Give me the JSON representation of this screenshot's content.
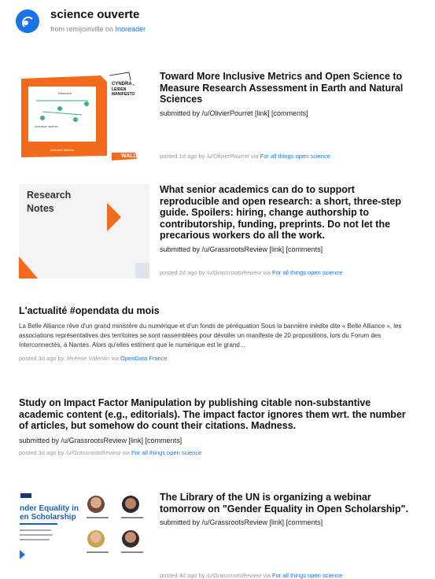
{
  "header": {
    "feed_title": "science ouverte",
    "from_prefix": "from remijoinville on",
    "from_service": "Inoreader"
  },
  "items": [
    {
      "title": "Toward More Inclusive Metrics and Open Science to Measure Research Assessment in Earth and Natural Sciences",
      "submitted": "submitted by /u/OlivierPourret [link] [comments]",
      "meta_prefix": "posted 1d ago by",
      "author": "/u/OlivierPourret",
      "via": "via",
      "source": "For all things open science",
      "thumb": {
        "words": [
          "CYNDRA , LEIDEN MANIFESTO",
          "WALL"
        ]
      }
    },
    {
      "title": "What senior academics can do to support reproducible and open research: a short, three-step guide. Spoilers: hiring, change authorship to contributorship, funding, preprints. Do not let the precarious workers do all the work.",
      "submitted": "submitted by /u/GrassrootsReview [link] [comments]",
      "meta_prefix": "posted 2d ago by",
      "author": "/u/GrassrootsReview",
      "via": "via",
      "source": "For all things open science",
      "thumb": {
        "label_line1": "Research",
        "label_line2": "Notes"
      }
    },
    {
      "title": "L'actualité #opendata du mois",
      "snippet": "La Belle Alliance rêve d'un grand ministère du numérique et d'un fonds de péréquation Sous la bannière inédite dite « Belle Alliance », les associations représentatives des territoires se sont rassemblées pour dévoiler un manifeste de 20 propositions, lors du Forum des Interconnectés, à Nantes. Alors qu'elles estiment que le numérique est le grand…",
      "meta_prefix": "posted 3d ago by",
      "author": "Jérémie Valentin",
      "via": "via",
      "source": "OpenData France"
    },
    {
      "title": "Study on Impact Factor Manipulation by publishing citable non-substantive academic content (e.g., editorials). The impact factor ignores them wrt. the number of articles, but somehow do count their citations. Madness.",
      "submitted": "submitted by /u/GrassrootsReview [link] [comments]",
      "meta_prefix": "posted 3d ago by",
      "author": "/u/GrassrootsReview",
      "via": "via",
      "source": "For all things open science"
    },
    {
      "title": "The Library of the UN is organizing a webinar tomorrow on \"Gender Equality in Open Scholarship\".",
      "submitted": "submitted by /u/GrassrootsReview [link] [comments]",
      "meta_prefix": "posted 4d ago by",
      "author": "/u/GrassrootsReview",
      "via": "via",
      "source": "For all things open science",
      "thumb": {
        "heading_line1": "nder Equality in",
        "heading_line2": "en Scholarship"
      }
    }
  ],
  "colors": {
    "accent": "#1a73e8",
    "orange": "#f26a1b"
  }
}
